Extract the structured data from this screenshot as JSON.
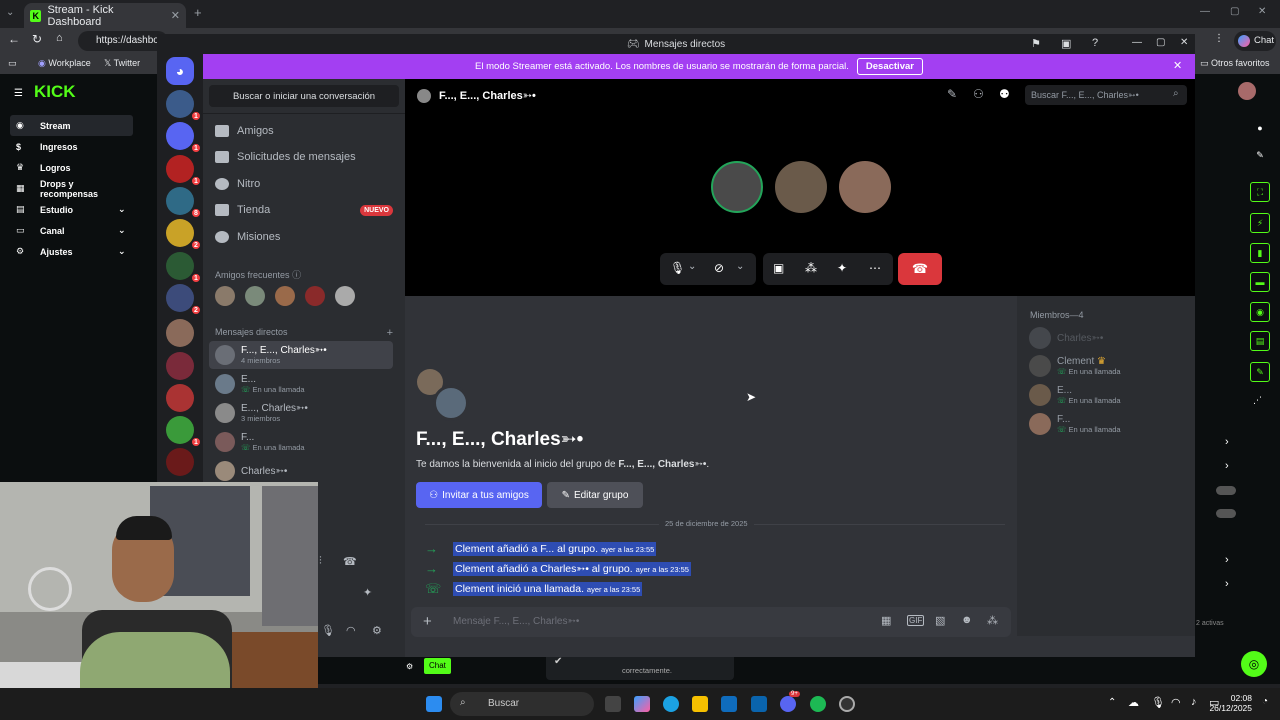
{
  "browser": {
    "tab_title": "Stream - Kick Dashboard",
    "url": "https://dashbo",
    "bookmarks": [
      "Workplace",
      "Twitter"
    ],
    "other_bookmarks": "Otros favoritos",
    "chat_button": "Chat"
  },
  "kick": {
    "logo": "KICK",
    "nav": [
      "Stream",
      "Ingresos",
      "Logros",
      "Drops y recompensas",
      "Estudio",
      "Canal",
      "Ajustes"
    ],
    "chat_tab": "Chat",
    "active_label": "2 activas",
    "toast": "correctamente."
  },
  "discord": {
    "window_title": "Mensajes directos",
    "banner_text": "El modo Streamer está activado. Los nombres de usuario se mostrarán de forma parcial.",
    "banner_button": "Desactivar",
    "search_placeholder": "Buscar o iniciar una conversación",
    "nav": [
      {
        "label": "Amigos"
      },
      {
        "label": "Solicitudes de mensajes"
      },
      {
        "label": "Nitro"
      },
      {
        "label": "Tienda",
        "badge": "NUEVO"
      },
      {
        "label": "Misiones"
      }
    ],
    "frequent_friends": "Amigos frecuentes",
    "direct_messages": "Mensajes directos",
    "dms": [
      {
        "name": "F..., E..., Charles➳•",
        "sub": "4 miembros"
      },
      {
        "name": "E...",
        "sub": "En una llamada"
      },
      {
        "name": "E..., Charles➳•",
        "sub": "3 miembros"
      },
      {
        "name": "F...",
        "sub": "En una llamada"
      },
      {
        "name": "Charles➳•",
        "sub": ""
      }
    ],
    "guild_badges": [
      "1",
      "1",
      "1",
      "8",
      "2",
      "1",
      "2",
      "1"
    ],
    "chat_header": "F..., E..., Charles➳•",
    "chat_search": "Buscar F..., E..., Charles➳•",
    "group_title": "F..., E..., Charles➳•",
    "welcome_prefix": "Te damos la bienvenida al inicio del grupo de ",
    "welcome_name": "F..., E..., Charles➳•",
    "invite_button": "Invitar a tus amigos",
    "edit_button": "Editar grupo",
    "date_divider": "25 de diciembre de 2025",
    "system_messages": [
      {
        "text": "Clement añadió a F... al grupo.",
        "time": "ayer a las 23:55"
      },
      {
        "text": "Clement añadió a Charles➳• al grupo.",
        "time": "ayer a las 23:55"
      },
      {
        "text": "Clement inició una llamada.",
        "time": "ayer a las 23:55"
      }
    ],
    "message_placeholder": "Mensaje F..., E..., Charles➳•",
    "members_header": "Miembros—4",
    "members": [
      {
        "name": "Charles➳•",
        "sub": ""
      },
      {
        "name": "Clement",
        "sub": "En una llamada"
      },
      {
        "name": "E...",
        "sub": "En una llamada"
      },
      {
        "name": "F...",
        "sub": "En una llamada"
      }
    ]
  },
  "taskbar": {
    "search": "Buscar",
    "time": "02:08",
    "date": "26/12/2025",
    "notif": "9+"
  },
  "colors": {
    "discord_blurple": "#5865f2",
    "kick_green": "#53fc18",
    "streamer_purple": "#a33ff2",
    "end_call": "#da373c"
  }
}
